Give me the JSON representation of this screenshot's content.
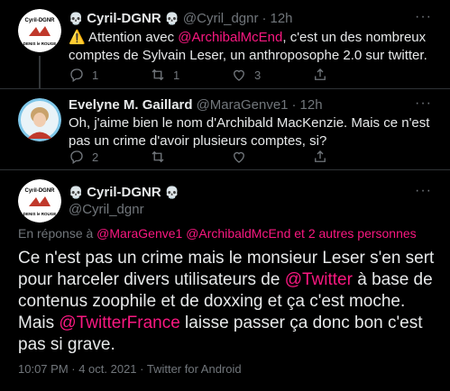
{
  "tweets": [
    {
      "name": "Cyril-DGNR",
      "handle": "@Cyril_dgnr",
      "time": "12h",
      "text_parts": {
        "p1": "⚠️ Attention avec ",
        "mention": "@ArchibalMcEnd",
        "p2": ", c'est un des nombreux comptes de Sylvain Leser, un anthroposophe 2.0 sur twitter."
      },
      "counts": {
        "reply": "1",
        "retweet": "1",
        "like": "3"
      },
      "avatar_text": {
        "top": "Cyril-DGNR",
        "bottom": "DENIS le ROUGE"
      }
    },
    {
      "name": "Evelyne M. Gaillard",
      "handle": "@MaraGenve1",
      "time": "12h",
      "text": "Oh, j'aime bien le nom d'Archibald MacKenzie. Mais ce n'est pas un crime d'avoir plusieurs comptes, si?",
      "counts": {
        "reply": "2"
      }
    }
  ],
  "main_tweet": {
    "name": "Cyril-DGNR",
    "handle": "@Cyril_dgnr",
    "reply_to": {
      "prefix": "En réponse à ",
      "mentions": "@MaraGenve1 @ArchibaldMcEnd",
      "suffix": " et 2 autres personnes"
    },
    "text_parts": {
      "p1": "Ce n'est pas un crime mais le monsieur Leser s'en sert pour harceler divers utilisateurs de ",
      "m1": "@Twitter",
      "p2": " à base de contenus zoophile et de doxxing et ça c'est moche. Mais ",
      "m2": "@TwitterFrance",
      "p3": " laisse passer ça donc bon c'est pas si grave."
    },
    "timestamp": "10:07 PM · 4 oct. 2021 · Twitter for Android"
  },
  "icons": [
    "skull-icon",
    "reply-icon",
    "retweet-icon",
    "like-icon",
    "share-icon",
    "more-icon"
  ],
  "colors": {
    "mention": "#f91880",
    "muted": "#71767b",
    "background": "#000000"
  }
}
